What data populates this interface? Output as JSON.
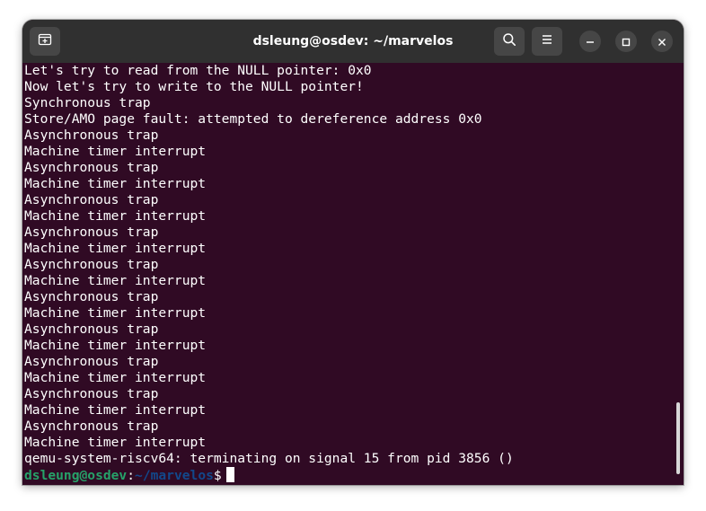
{
  "window": {
    "title": "dsleung@osdev: ~/marvelos",
    "colors": {
      "terminal_background": "#300a24",
      "titlebar_background": "#303030",
      "prompt_user": "#26a269",
      "prompt_path": "#12488b",
      "text": "#ffffff"
    }
  },
  "titlebar": {
    "new_tab_icon": "new-tab-icon",
    "search_icon": "search-icon",
    "menu_icon": "hamburger-menu-icon",
    "minimize_icon": "minimize-icon",
    "maximize_icon": "maximize-icon",
    "close_icon": "close-icon"
  },
  "terminal": {
    "lines": [
      "Let's try to read from the NULL pointer: 0x0",
      "Now let's try to write to the NULL pointer!",
      "Synchronous trap",
      "Store/AMO page fault: attempted to dereference address 0x0",
      "Asynchronous trap",
      "Machine timer interrupt",
      "Asynchronous trap",
      "Machine timer interrupt",
      "Asynchronous trap",
      "Machine timer interrupt",
      "Asynchronous trap",
      "Machine timer interrupt",
      "Asynchronous trap",
      "Machine timer interrupt",
      "Asynchronous trap",
      "Machine timer interrupt",
      "Asynchronous trap",
      "Machine timer interrupt",
      "Asynchronous trap",
      "Machine timer interrupt",
      "Asynchronous trap",
      "Machine timer interrupt",
      "Asynchronous trap",
      "Machine timer interrupt",
      "qemu-system-riscv64: terminating on signal 15 from pid 3856 ()"
    ],
    "prompt": {
      "user_host": "dsleung@osdev",
      "separator": ":",
      "path": "~/marvelos",
      "symbol": "$"
    },
    "scroll_position": 0.97,
    "visible_fraction": 0.17
  }
}
